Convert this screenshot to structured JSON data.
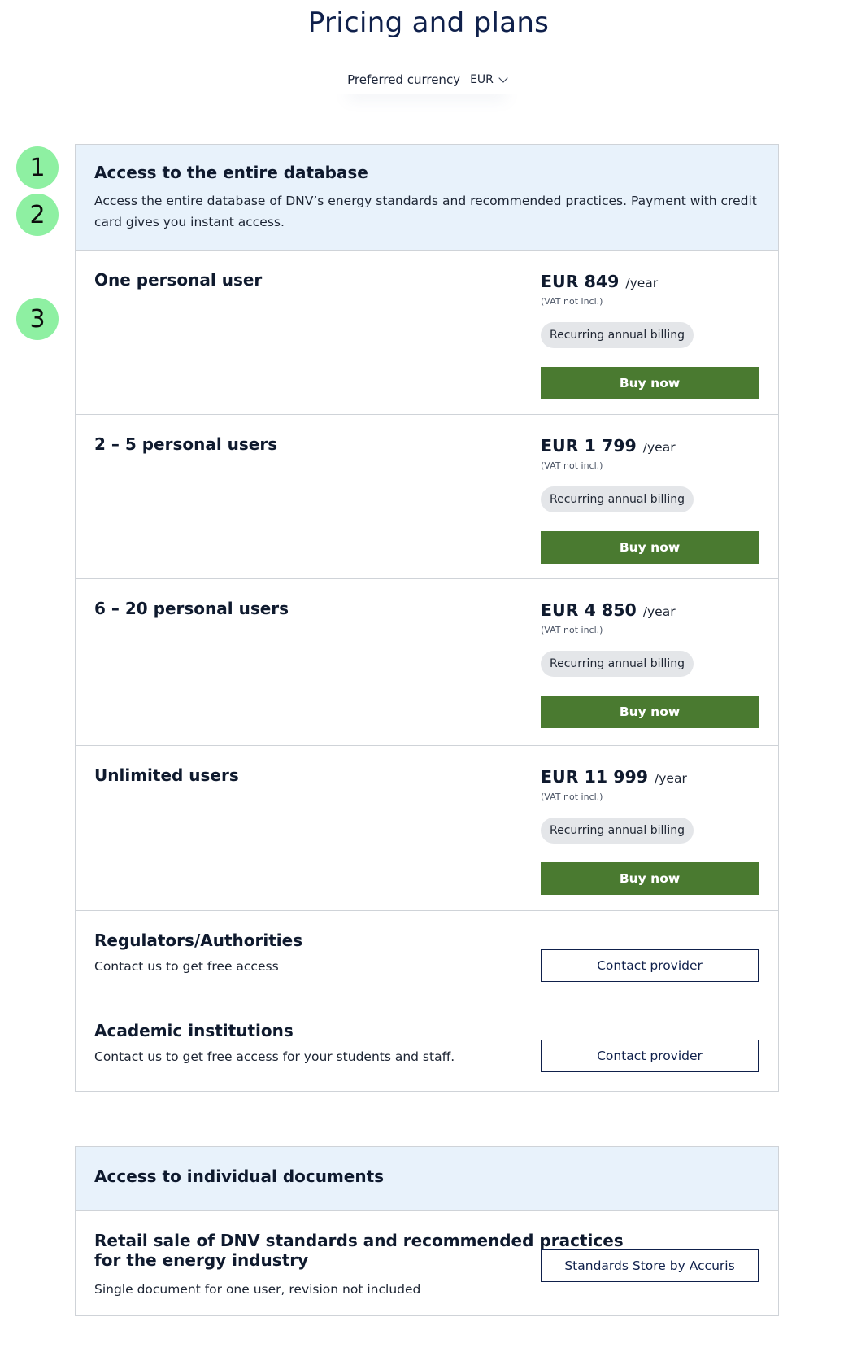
{
  "page": {
    "title": "Pricing and plans"
  },
  "currency": {
    "label": "Preferred currency",
    "value": "EUR"
  },
  "steps": [
    "1",
    "2",
    "3"
  ],
  "database": {
    "title": "Access to the entire database",
    "description": "Access the entire database of DNV’s energy standards and recommended practices. Payment with credit card gives you instant access.",
    "plans": [
      {
        "title": "One personal user",
        "price": "EUR 849",
        "period": "/year",
        "vat": "(VAT not incl.)",
        "billing": "Recurring annual billing",
        "button": "Buy now"
      },
      {
        "title": "2 – 5 personal users",
        "price": "EUR 1 799",
        "period": "/year",
        "vat": "(VAT not incl.)",
        "billing": "Recurring annual billing",
        "button": "Buy now"
      },
      {
        "title": "6 – 20 personal users",
        "price": "EUR 4 850",
        "period": "/year",
        "vat": "(VAT not incl.)",
        "billing": "Recurring annual billing",
        "button": "Buy now"
      },
      {
        "title": "Unlimited users",
        "price": "EUR 11 999",
        "period": "/year",
        "vat": "(VAT not incl.)",
        "billing": "Recurring annual billing",
        "button": "Buy now"
      }
    ],
    "regulators": {
      "title": "Regulators/Authorities",
      "description": "Contact us to get free access",
      "button": "Contact provider"
    },
    "academic": {
      "title": "Academic institutions",
      "description": "Contact us to get free access for your students and staff.",
      "button": "Contact provider"
    }
  },
  "individual": {
    "title": "Access to individual documents",
    "retail": {
      "title_line1": "Retail sale of DNV standards and recommended practices",
      "title_line2": "for the energy industry",
      "description": "Single document for one user, revision not included",
      "button": "Standards Store by Accuris"
    }
  },
  "colors": {
    "accent_green": "#4a7a30",
    "navy": "#0f204b",
    "header_bg": "#e8f2fb",
    "step_badge": "#8ef0a2"
  }
}
